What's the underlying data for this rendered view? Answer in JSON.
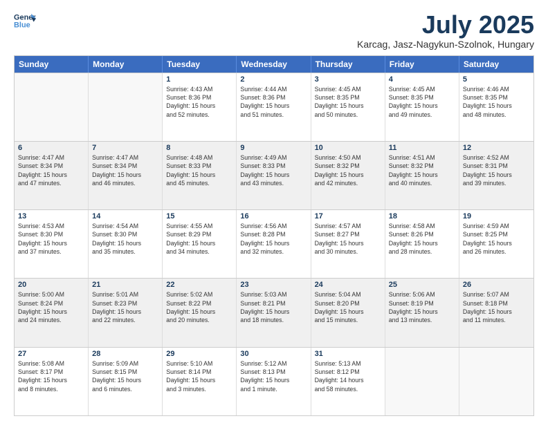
{
  "logo": {
    "line1": "General",
    "line2": "Blue"
  },
  "title": "July 2025",
  "location": "Karcag, Jasz-Nagykun-Szolnok, Hungary",
  "days_of_week": [
    "Sunday",
    "Monday",
    "Tuesday",
    "Wednesday",
    "Thursday",
    "Friday",
    "Saturday"
  ],
  "weeks": [
    [
      {
        "day": "",
        "info": "",
        "empty": true
      },
      {
        "day": "",
        "info": "",
        "empty": true
      },
      {
        "day": "1",
        "info": "Sunrise: 4:43 AM\nSunset: 8:36 PM\nDaylight: 15 hours\nand 52 minutes."
      },
      {
        "day": "2",
        "info": "Sunrise: 4:44 AM\nSunset: 8:36 PM\nDaylight: 15 hours\nand 51 minutes."
      },
      {
        "day": "3",
        "info": "Sunrise: 4:45 AM\nSunset: 8:35 PM\nDaylight: 15 hours\nand 50 minutes."
      },
      {
        "day": "4",
        "info": "Sunrise: 4:45 AM\nSunset: 8:35 PM\nDaylight: 15 hours\nand 49 minutes."
      },
      {
        "day": "5",
        "info": "Sunrise: 4:46 AM\nSunset: 8:35 PM\nDaylight: 15 hours\nand 48 minutes."
      }
    ],
    [
      {
        "day": "6",
        "info": "Sunrise: 4:47 AM\nSunset: 8:34 PM\nDaylight: 15 hours\nand 47 minutes."
      },
      {
        "day": "7",
        "info": "Sunrise: 4:47 AM\nSunset: 8:34 PM\nDaylight: 15 hours\nand 46 minutes."
      },
      {
        "day": "8",
        "info": "Sunrise: 4:48 AM\nSunset: 8:33 PM\nDaylight: 15 hours\nand 45 minutes."
      },
      {
        "day": "9",
        "info": "Sunrise: 4:49 AM\nSunset: 8:33 PM\nDaylight: 15 hours\nand 43 minutes."
      },
      {
        "day": "10",
        "info": "Sunrise: 4:50 AM\nSunset: 8:32 PM\nDaylight: 15 hours\nand 42 minutes."
      },
      {
        "day": "11",
        "info": "Sunrise: 4:51 AM\nSunset: 8:32 PM\nDaylight: 15 hours\nand 40 minutes."
      },
      {
        "day": "12",
        "info": "Sunrise: 4:52 AM\nSunset: 8:31 PM\nDaylight: 15 hours\nand 39 minutes."
      }
    ],
    [
      {
        "day": "13",
        "info": "Sunrise: 4:53 AM\nSunset: 8:30 PM\nDaylight: 15 hours\nand 37 minutes."
      },
      {
        "day": "14",
        "info": "Sunrise: 4:54 AM\nSunset: 8:30 PM\nDaylight: 15 hours\nand 35 minutes."
      },
      {
        "day": "15",
        "info": "Sunrise: 4:55 AM\nSunset: 8:29 PM\nDaylight: 15 hours\nand 34 minutes."
      },
      {
        "day": "16",
        "info": "Sunrise: 4:56 AM\nSunset: 8:28 PM\nDaylight: 15 hours\nand 32 minutes."
      },
      {
        "day": "17",
        "info": "Sunrise: 4:57 AM\nSunset: 8:27 PM\nDaylight: 15 hours\nand 30 minutes."
      },
      {
        "day": "18",
        "info": "Sunrise: 4:58 AM\nSunset: 8:26 PM\nDaylight: 15 hours\nand 28 minutes."
      },
      {
        "day": "19",
        "info": "Sunrise: 4:59 AM\nSunset: 8:25 PM\nDaylight: 15 hours\nand 26 minutes."
      }
    ],
    [
      {
        "day": "20",
        "info": "Sunrise: 5:00 AM\nSunset: 8:24 PM\nDaylight: 15 hours\nand 24 minutes."
      },
      {
        "day": "21",
        "info": "Sunrise: 5:01 AM\nSunset: 8:23 PM\nDaylight: 15 hours\nand 22 minutes."
      },
      {
        "day": "22",
        "info": "Sunrise: 5:02 AM\nSunset: 8:22 PM\nDaylight: 15 hours\nand 20 minutes."
      },
      {
        "day": "23",
        "info": "Sunrise: 5:03 AM\nSunset: 8:21 PM\nDaylight: 15 hours\nand 18 minutes."
      },
      {
        "day": "24",
        "info": "Sunrise: 5:04 AM\nSunset: 8:20 PM\nDaylight: 15 hours\nand 15 minutes."
      },
      {
        "day": "25",
        "info": "Sunrise: 5:06 AM\nSunset: 8:19 PM\nDaylight: 15 hours\nand 13 minutes."
      },
      {
        "day": "26",
        "info": "Sunrise: 5:07 AM\nSunset: 8:18 PM\nDaylight: 15 hours\nand 11 minutes."
      }
    ],
    [
      {
        "day": "27",
        "info": "Sunrise: 5:08 AM\nSunset: 8:17 PM\nDaylight: 15 hours\nand 8 minutes."
      },
      {
        "day": "28",
        "info": "Sunrise: 5:09 AM\nSunset: 8:15 PM\nDaylight: 15 hours\nand 6 minutes."
      },
      {
        "day": "29",
        "info": "Sunrise: 5:10 AM\nSunset: 8:14 PM\nDaylight: 15 hours\nand 3 minutes."
      },
      {
        "day": "30",
        "info": "Sunrise: 5:12 AM\nSunset: 8:13 PM\nDaylight: 15 hours\nand 1 minute."
      },
      {
        "day": "31",
        "info": "Sunrise: 5:13 AM\nSunset: 8:12 PM\nDaylight: 14 hours\nand 58 minutes."
      },
      {
        "day": "",
        "info": "",
        "empty": true
      },
      {
        "day": "",
        "info": "",
        "empty": true
      }
    ]
  ]
}
